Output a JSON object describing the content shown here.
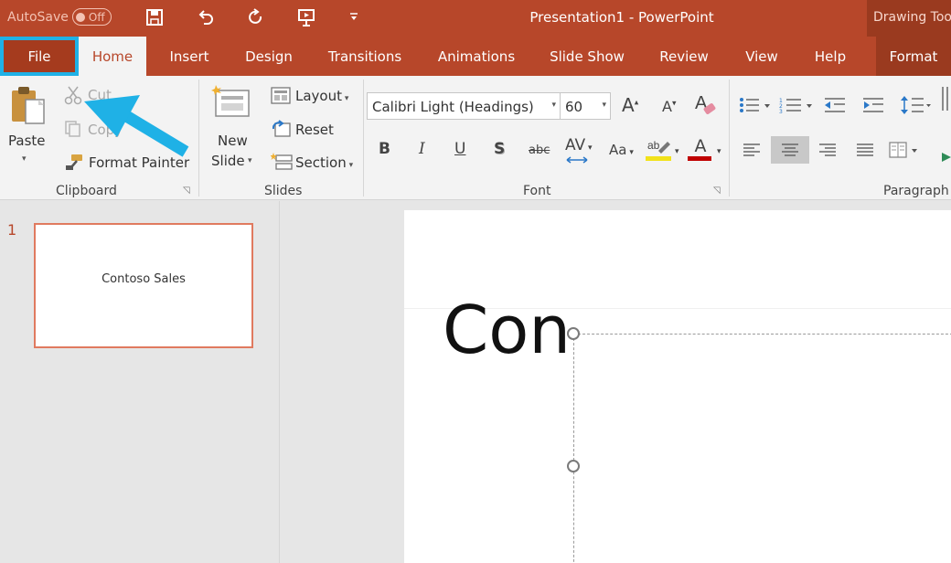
{
  "titlebar": {
    "autosave_label": "AutoSave",
    "autosave_state": "Off",
    "title": "Presentation1  -  PowerPoint",
    "contextual_tab_group": "Drawing Tools"
  },
  "tabs": [
    {
      "label": "File"
    },
    {
      "label": "Home"
    },
    {
      "label": "Insert"
    },
    {
      "label": "Design"
    },
    {
      "label": "Transitions"
    },
    {
      "label": "Animations"
    },
    {
      "label": "Slide Show"
    },
    {
      "label": "Review"
    },
    {
      "label": "View"
    },
    {
      "label": "Help"
    },
    {
      "label": "Format"
    }
  ],
  "ribbon": {
    "clipboard": {
      "paste": "Paste",
      "cut": "Cut",
      "copy": "Copy",
      "format_painter": "Format Painter",
      "group_label": "Clipboard"
    },
    "slides": {
      "new_slide_line1": "New",
      "new_slide_line2": "Slide",
      "layout": "Layout",
      "reset": "Reset",
      "section": "Section",
      "group_label": "Slides"
    },
    "font": {
      "font_name": "Calibri Light (Headings)",
      "font_size": "60",
      "grow": "A",
      "shrink": "A",
      "bold": "B",
      "italic": "I",
      "underline": "U",
      "shadow": "S",
      "strikethrough": "abc",
      "char_spacing": "AV",
      "change_case": "Aa",
      "font_color": "A",
      "group_label": "Font"
    },
    "paragraph": {
      "group_label": "Paragraph"
    }
  },
  "slides_pane": {
    "slide_number": "1",
    "thumbnail_text": "Contoso Sales"
  },
  "slide": {
    "title_text_visible": "Con"
  },
  "colors": {
    "accent": "#b7472a",
    "highlight": "#1fb1e6"
  }
}
